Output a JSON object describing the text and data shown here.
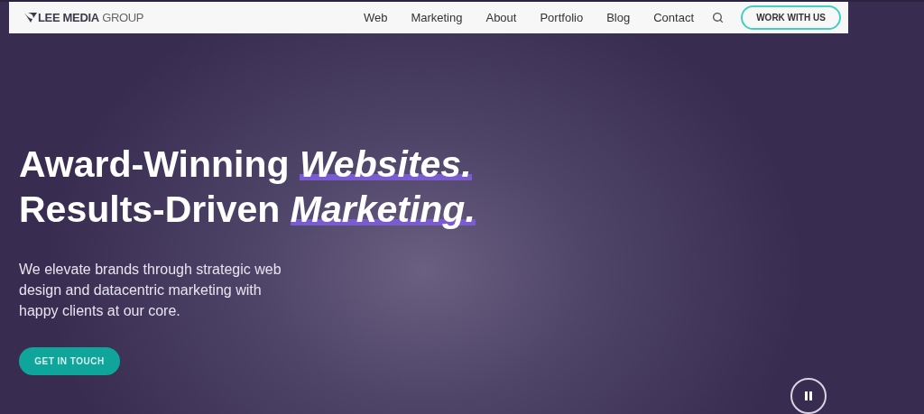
{
  "header": {
    "logo": {
      "bold": "LEE MEDIA",
      "light": "GROUP"
    },
    "nav": [
      "Web",
      "Marketing",
      "About",
      "Portfolio",
      "Blog",
      "Contact"
    ],
    "cta": "WORK WITH US"
  },
  "hero": {
    "headline": [
      {
        "text": "Award-Winning ",
        "emphasis": "Websites."
      },
      {
        "text": "Results-Driven ",
        "emphasis": "Marketing."
      }
    ],
    "intro": "We elevate brands through strategic web design and datacentric marketing with happy clients at our core.",
    "button": "GET IN TOUCH",
    "video_playing": true
  }
}
